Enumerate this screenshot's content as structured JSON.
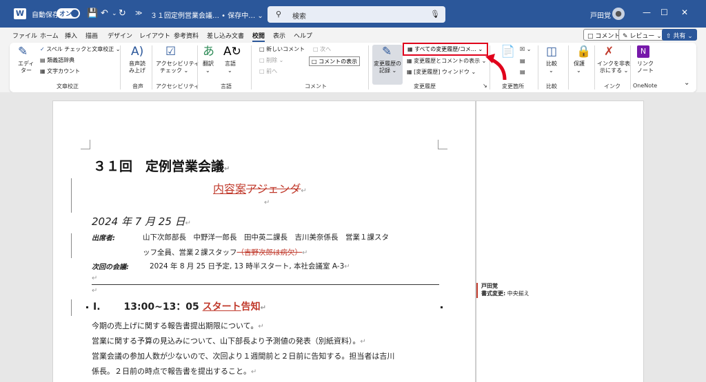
{
  "titlebar": {
    "logo": "W",
    "autosave_label": "自動保存",
    "autosave_state": "オン",
    "doc_title": "３１回定例営業会議… • 保存中… ⌄",
    "search_placeholder": "検索",
    "username": "戸田覚"
  },
  "menu": {
    "tabs": [
      "ファイル",
      "ホーム",
      "挿入",
      "描画",
      "デザイン",
      "レイアウト",
      "参考資料",
      "差し込み文書",
      "校閲",
      "表示",
      "ヘルプ"
    ],
    "active_tab": "校閲",
    "comment_btn": "コメント",
    "review_btn": "レビュー",
    "share_btn": "共有"
  },
  "ribbon": {
    "editor_1": "エディ",
    "editor_2": "ター",
    "spell": "スペル チェックと文章校正",
    "thesaurus": "類義語辞典",
    "wordcount": "文字カウント",
    "group_proofing": "文章校正",
    "read_1": "音声読",
    "read_2": "み上げ",
    "group_voice": "音声",
    "access_1": "アクセシビリティ",
    "access_2": "チェック",
    "group_access": "アクセシビリティ",
    "translate": "翻訳",
    "language": "言語",
    "group_language": "言語",
    "new_comment": "新しいコメント",
    "delete": "削除",
    "previous": "前へ",
    "next": "次へ",
    "show_comments": "コメントの表示",
    "group_comment": "コメント",
    "track_1": "変更履歴の",
    "track_2": "記録",
    "all_markup": "すべての変更履歴/コメ…",
    "show_markup": "変更履歴とコメントの表示",
    "pane": "[変更履歴] ウィンドウ",
    "group_tracking": "変更履歴",
    "group_changes": "変更箇所",
    "compare": "比較",
    "group_compare": "比較",
    "protect": "保護",
    "ink_1": "インクを非表",
    "ink_2": "示にする",
    "group_ink": "インク",
    "link_1": "リンク",
    "link_2": "ノート",
    "group_onenote": "OneNote"
  },
  "document": {
    "title": "３１回　定例営業会議",
    "subtitle_ins": "内容案",
    "subtitle_del": "アジェンダ",
    "date": "2024 年 7 月 25 日",
    "attendees_label": "出席者:",
    "attendees_1": "山下次郎部長　中野洋一郎長　田中英二課長　吉川美奈係長　営業１課スタ",
    "attendees_2": "ッフ全員、営業２課スタッフ",
    "attendees_del": "（吉野次郎は病欠）",
    "next_label": "次回の会議:",
    "next_text": "2024 年 8 月 25 日予定, 13 時半スタート, 本社会議室 A-3",
    "item_num": "I.",
    "item_time": "13:00~13：05 ",
    "item_ins": "スタート",
    "item_rest": "告知",
    "body_1": "今期の売上げに関する報告書提出期限について。",
    "body_2": "営業に関する予算の見込みについて、山下部長より予測値の発表（別紙資料）。",
    "body_3": "営業会議の参加人数が少ないので、次回より１週間前と２日前に告知する。担当者は吉川",
    "body_4": "係長。２日前の時点で報告書を提出すること。",
    "para_mark": "↵"
  },
  "balloon": {
    "author": "戸田覚",
    "label": "書式変更:",
    "value": "中央揃え"
  }
}
